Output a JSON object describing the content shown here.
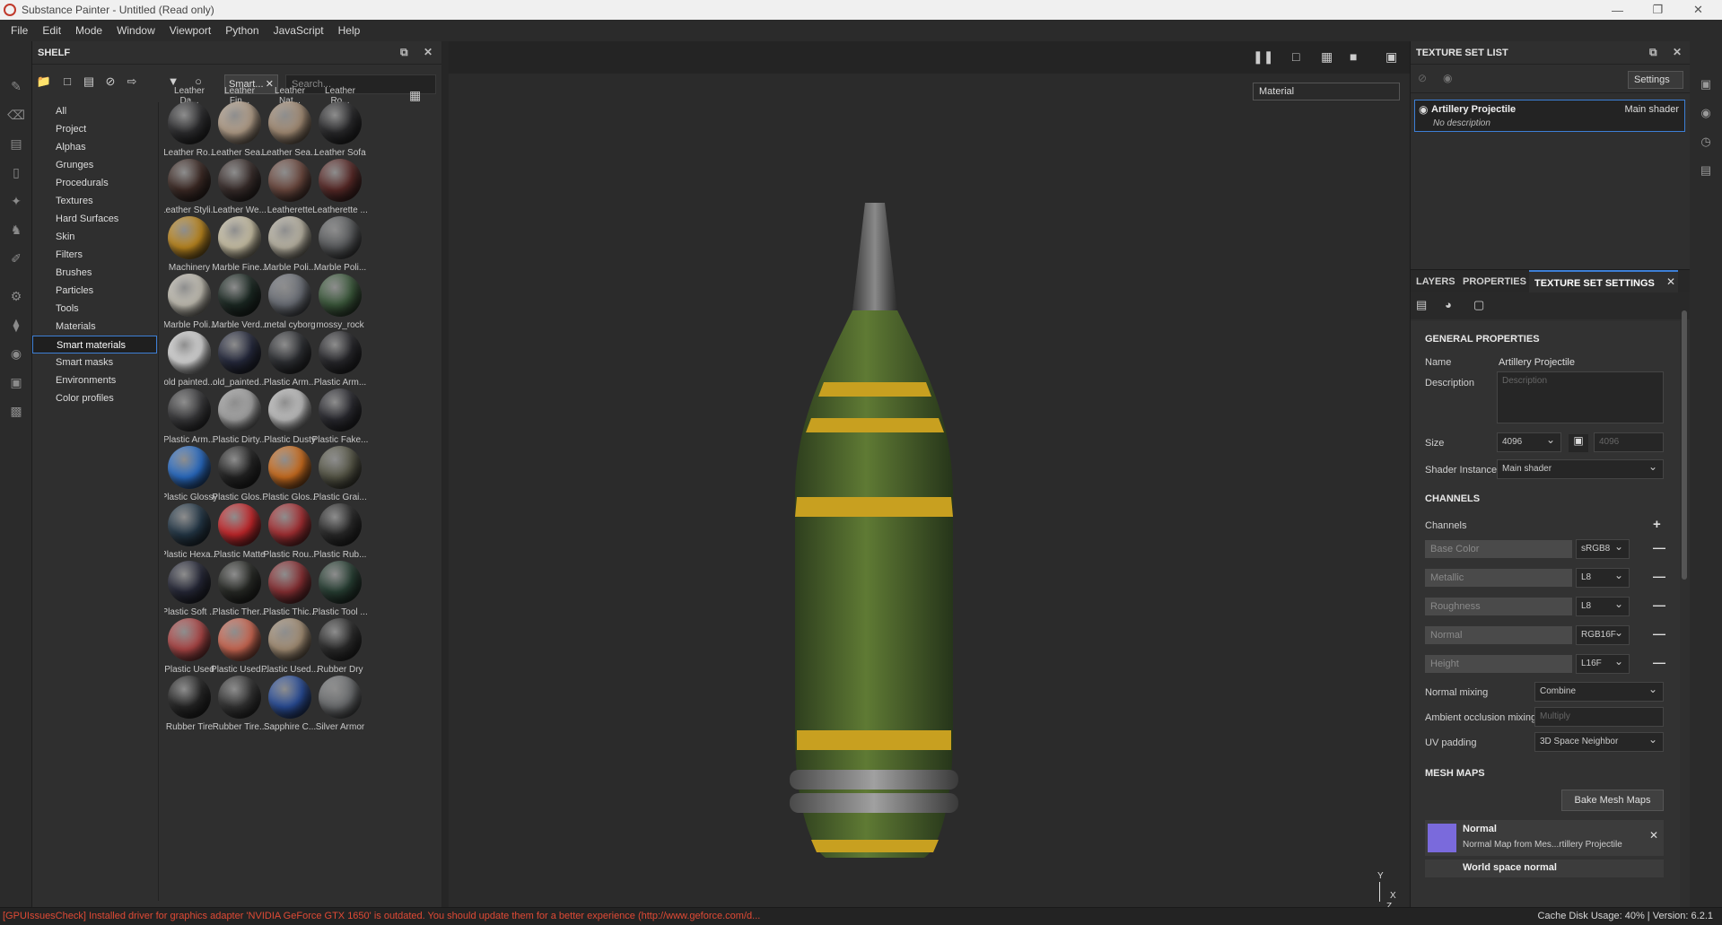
{
  "window": {
    "title": "Substance Painter - Untitled (Read only)"
  },
  "menu": [
    "File",
    "Edit",
    "Mode",
    "Window",
    "Viewport",
    "Python",
    "JavaScript",
    "Help"
  ],
  "shelf": {
    "title": "SHELF",
    "filter_tag": "Smart...",
    "search_placeholder": "Search...",
    "categories": [
      "All",
      "Project",
      "Alphas",
      "Grunges",
      "Procedurals",
      "Textures",
      "Hard Surfaces",
      "Skin",
      "Filters",
      "Brushes",
      "Particles",
      "Tools",
      "Materials",
      "Smart materials",
      "Smart masks",
      "Environments",
      "Color profiles"
    ],
    "active_category": "Smart materials",
    "header_labels": [
      "Leather Da...",
      "Leather Fin...",
      "Leather Nat...",
      "Leather Ro..."
    ],
    "items": [
      {
        "label": "Leather Ro...",
        "color": "#2e2e30"
      },
      {
        "label": "Leather Sea...",
        "color": "#b7a28c"
      },
      {
        "label": "Leather Sea...",
        "color": "#a89078"
      },
      {
        "label": "Leather Sofa",
        "color": "#2a2a2c"
      },
      {
        "label": "Leather Styli...",
        "color": "#3e2b26"
      },
      {
        "label": "Leather We...",
        "color": "#3a2e2c"
      },
      {
        "label": "Leatherette",
        "color": "#6e4a40"
      },
      {
        "label": "Leatherette ...",
        "color": "#5a2a28"
      },
      {
        "label": "Machinery",
        "color": "#c08a20"
      },
      {
        "label": "Marble Fine...",
        "color": "#cfc6aa"
      },
      {
        "label": "Marble Poli...",
        "color": "#bfb9a8"
      },
      {
        "label": "Marble Poli...",
        "color": "#5a5c5e"
      },
      {
        "label": "Marble Poli...",
        "color": "#c8c4b8"
      },
      {
        "label": "Marble Verd...",
        "color": "#1c2a24"
      },
      {
        "label": "metal cyborg",
        "color": "#6c7078"
      },
      {
        "label": "mossy_rock",
        "color": "#3c5a3c"
      },
      {
        "label": "old painted...",
        "color": "#dcdcdc"
      },
      {
        "label": "old_painted...",
        "color": "#262a3e"
      },
      {
        "label": "Plastic Arm...",
        "color": "#2e3034"
      },
      {
        "label": "Plastic Arm...",
        "color": "#28282c"
      },
      {
        "label": "Plastic Arm...",
        "color": "#3a3a3c"
      },
      {
        "label": "Plastic Dirty...",
        "color": "#a8a8a8"
      },
      {
        "label": "Plastic Dusty",
        "color": "#c4c4c4"
      },
      {
        "label": "Plastic Fake...",
        "color": "#2a2a30"
      },
      {
        "label": "Plastic Glossy",
        "color": "#2a6ec8"
      },
      {
        "label": "Plastic Glos...",
        "color": "#242424"
      },
      {
        "label": "Plastic Glos...",
        "color": "#d07020"
      },
      {
        "label": "Plastic Grai...",
        "color": "#585848"
      },
      {
        "label": "Plastic Hexa...",
        "color": "#243848"
      },
      {
        "label": "Plastic Matte",
        "color": "#c8282c"
      },
      {
        "label": "Plastic Rou...",
        "color": "#a83034"
      },
      {
        "label": "Plastic Rub...",
        "color": "#2a2a2a"
      },
      {
        "label": "Plastic Soft ...",
        "color": "#262838"
      },
      {
        "label": "Plastic Ther...",
        "color": "#282a26"
      },
      {
        "label": "Plastic Thic...",
        "color": "#8a3034"
      },
      {
        "label": "Plastic Tool ...",
        "color": "#284034"
      },
      {
        "label": "Plastic Used",
        "color": "#b04848"
      },
      {
        "label": "Plastic Used...",
        "color": "#d06a54"
      },
      {
        "label": "Plastic Used...",
        "color": "#a89278"
      },
      {
        "label": "Rubber Dry",
        "color": "#2c2c2c"
      },
      {
        "label": "Rubber Tire",
        "color": "#262626"
      },
      {
        "label": "Rubber Tire...",
        "color": "#343434"
      },
      {
        "label": "Sapphire C...",
        "color": "#2a4e9a"
      },
      {
        "label": "Silver Armor",
        "color": "#6c6e70"
      }
    ]
  },
  "viewport": {
    "material_select": "Material",
    "axis_y": "Y",
    "axis_x": "X",
    "axis_z": "Z"
  },
  "texture_set_list": {
    "title": "TEXTURE SET LIST",
    "settings_label": "Settings",
    "item_name": "Artillery Projectile",
    "item_shader": "Main shader",
    "item_desc": "No description"
  },
  "tabs": {
    "layers": "LAYERS",
    "properties": "PROPERTIES",
    "tss": "TEXTURE SET SETTINGS"
  },
  "tss": {
    "general": "GENERAL PROPERTIES",
    "name_label": "Name",
    "name_value": "Artillery Projectile",
    "desc_label": "Description",
    "desc_placeholder": "Description",
    "size_label": "Size",
    "size_value": "4096",
    "size_value2": "4096",
    "shader_label": "Shader Instance",
    "shader_value": "Main shader",
    "channels_title": "CHANNELS",
    "channels_label": "Channels",
    "channels": [
      {
        "name": "Base Color",
        "format": "sRGB8"
      },
      {
        "name": "Metallic",
        "format": "L8"
      },
      {
        "name": "Roughness",
        "format": "L8"
      },
      {
        "name": "Normal",
        "format": "RGB16F"
      },
      {
        "name": "Height",
        "format": "L16F"
      }
    ],
    "normal_mixing_label": "Normal mixing",
    "normal_mixing_value": "Combine",
    "ao_mixing_label": "Ambient occlusion mixing",
    "ao_mixing_value": "Multiply",
    "uv_padding_label": "UV padding",
    "uv_padding_value": "3D Space Neighbor",
    "mesh_maps_title": "MESH MAPS",
    "bake_label": "Bake Mesh Maps",
    "mesh_item_title": "Normal",
    "mesh_item_sub": "Normal Map from Mes...rtillery Projectile",
    "mesh_item2": "World space normal"
  },
  "status": {
    "error": "[GPUIssuesCheck] Installed driver for graphics adapter 'NVIDIA GeForce GTX 1650' is outdated. You should update them for a better experience (http://www.geforce.com/d...",
    "cache": "Cache Disk Usage:   40% | Version: 6.2.1"
  }
}
